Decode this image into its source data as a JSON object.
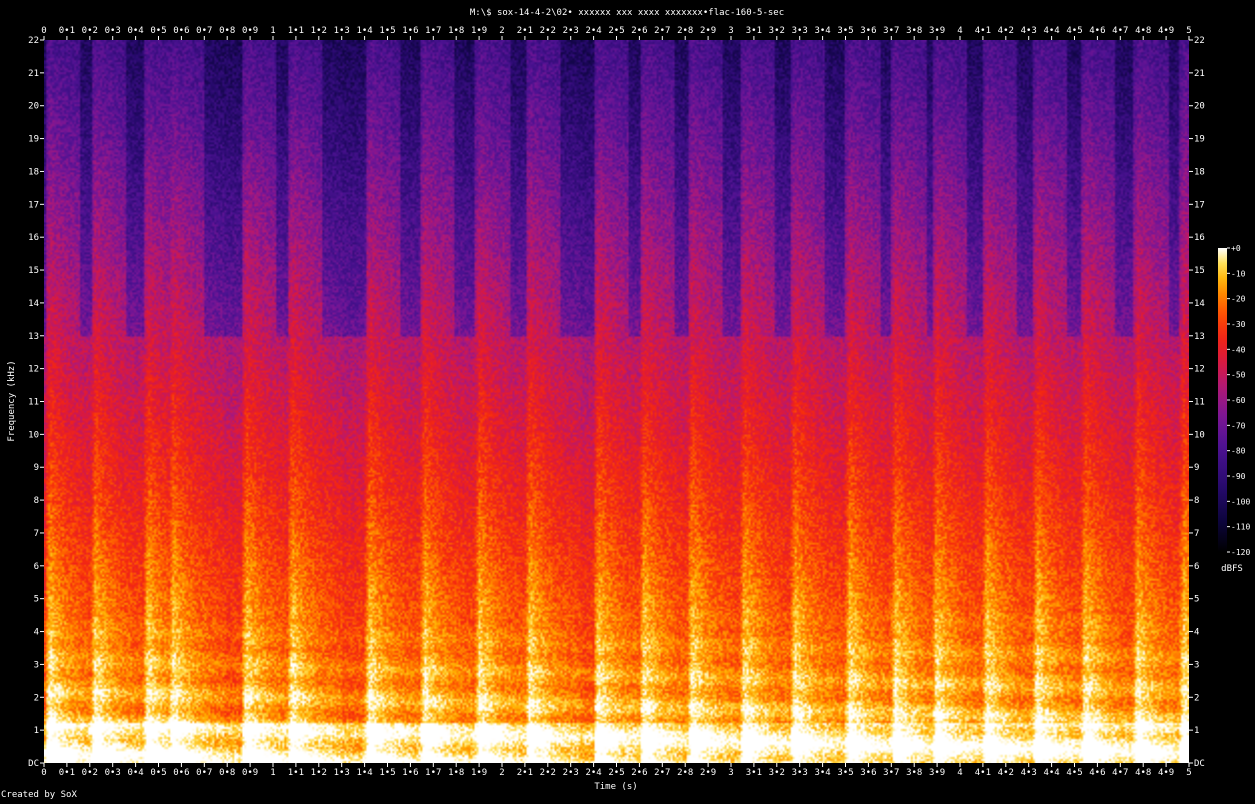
{
  "chart_data": {
    "type": "heatmap",
    "title": "M:\\$ sox-14-4-2\\02• xxxxxx xxx xxxx xxxxxxx•flac-160-5-sec",
    "xlabel": "Time (s)",
    "ylabel": "Frequency (kHz)",
    "xlim": [
      0,
      5
    ],
    "ylim": [
      0,
      22
    ],
    "x_ticks": [
      "0",
      "0•1",
      "0•2",
      "0•3",
      "0•4",
      "0•5",
      "0•6",
      "0•7",
      "0•8",
      "0•9",
      "1",
      "1•1",
      "1•2",
      "1•3",
      "1•4",
      "1•5",
      "1•6",
      "1•7",
      "1•8",
      "1•9",
      "2",
      "2•1",
      "2•2",
      "2•3",
      "2•4",
      "2•5",
      "2•6",
      "2•7",
      "2•8",
      "2•9",
      "3",
      "3•1",
      "3•2",
      "3•3",
      "3•4",
      "3•5",
      "3•6",
      "3•7",
      "3•8",
      "3•9",
      "4",
      "4•1",
      "4•2",
      "4•3",
      "4•4",
      "4•5",
      "4•6",
      "4•7",
      "4•8",
      "4•9",
      "5"
    ],
    "y_ticks": [
      "DC",
      "1",
      "2",
      "3",
      "4",
      "5",
      "6",
      "7",
      "8",
      "9",
      "10",
      "11",
      "12",
      "13",
      "14",
      "15",
      "16",
      "17",
      "18",
      "19",
      "20",
      "21",
      "22"
    ],
    "colorbar": {
      "label": "dBFS",
      "range": [
        -120,
        0
      ],
      "ticks": [
        "+0",
        "-10",
        "-20",
        "-30",
        "-40",
        "-50",
        "-60",
        "-70",
        "-80",
        "-90",
        "-100",
        "-110",
        "-120"
      ]
    },
    "credit": "Created by SoX",
    "grid": false
  },
  "colors": {
    "background": "#000000",
    "text": "#ffffff",
    "palette": [
      "#000000",
      "#0a0535",
      "#2a0a6a",
      "#4a1290",
      "#7a1aa0",
      "#b0208a",
      "#dd1a3a",
      "#f03010",
      "#ff6a00",
      "#ffb000",
      "#ffe060",
      "#ffffff"
    ]
  }
}
